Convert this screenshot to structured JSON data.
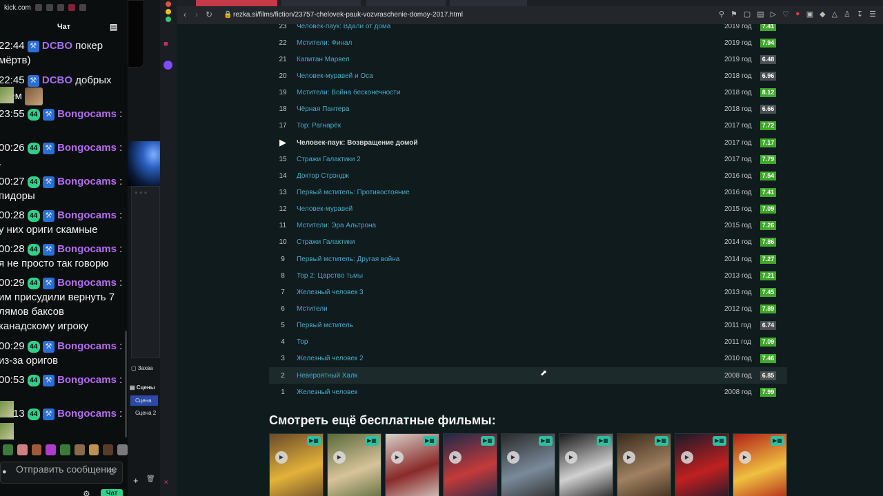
{
  "chat": {
    "site": "kick.com",
    "header": "Чат",
    "messages": [
      {
        "time": "22:44",
        "badges": [
          "hammer"
        ],
        "user": "DCBO",
        "text": "покер",
        "text2": "мёртв)"
      },
      {
        "time": "22:45",
        "badges": [
          "hammer"
        ],
        "user": "DCBO",
        "text": "добрых",
        "text2": "всем"
      },
      {
        "time": "23:55",
        "badges": [
          "44",
          "hammer"
        ],
        "user": "Bongocams",
        "text": ":",
        "text2": ""
      },
      {
        "time": "00:26",
        "badges": [
          "44",
          "hammer"
        ],
        "user": "Bongocams",
        "text": ":",
        "text2": "."
      },
      {
        "time": "00:27",
        "badges": [
          "44",
          "hammer"
        ],
        "user": "Bongocams",
        "text": ":",
        "text2": "пидоры"
      },
      {
        "time": "00:28",
        "badges": [
          "44",
          "hammer"
        ],
        "user": "Bongocams",
        "text": ":",
        "text2": "у них ориги скамные"
      },
      {
        "time": "00:28",
        "badges": [
          "44",
          "hammer"
        ],
        "user": "Bongocams",
        "text": ":",
        "text2": "я не просто так говорю"
      },
      {
        "time": "00:29",
        "badges": [
          "44",
          "hammer"
        ],
        "user": "Bongocams",
        "text": ":",
        "text2": "им присудили вернуть 7",
        "text3": "лямов баксов",
        "text4": "канадскому игроку"
      },
      {
        "time": "00:29",
        "badges": [
          "44",
          "hammer"
        ],
        "user": "Bongocams",
        "text": ":",
        "text2": "из-за оригов"
      },
      {
        "time": "00:53",
        "badges": [
          "44",
          "hammer"
        ],
        "user": "Bongocams",
        "text": ":",
        "text2": ""
      },
      {
        "time": "01:13",
        "badges": [
          "44",
          "hammer"
        ],
        "user": "Bongocams",
        "text": ":",
        "text2": ""
      }
    ],
    "input_placeholder": "Отправить сообщение",
    "send_label": "Чат"
  },
  "obs": {
    "capture_label": "Захва",
    "scenes_header": "Сцены",
    "scenes": [
      "Сцена",
      "Сцена 2"
    ]
  },
  "browser": {
    "url": "rezka.si/films/fiction/23757-chelovek-pauk-vozvraschenie-domoy-2017.html"
  },
  "list": [
    {
      "num": "23",
      "title": "Человек-паук: Вдали от дома",
      "year": "2019 год",
      "rating": "7.41",
      "color": "g"
    },
    {
      "num": "22",
      "title": "Мстители: Финал",
      "year": "2019 год",
      "rating": "7.94",
      "color": "g"
    },
    {
      "num": "21",
      "title": "Капитан Марвел",
      "year": "2019 год",
      "rating": "6.48",
      "color": "r"
    },
    {
      "num": "20",
      "title": "Человек-муравей и Оса",
      "year": "2018 год",
      "rating": "6.96",
      "color": "r"
    },
    {
      "num": "19",
      "title": "Мстители: Война бесконечности",
      "year": "2018 год",
      "rating": "8.12",
      "color": "g"
    },
    {
      "num": "18",
      "title": "Чёрная Пантера",
      "year": "2018 год",
      "rating": "6.66",
      "color": "r"
    },
    {
      "num": "17",
      "title": "Тор: Рагнарёк",
      "year": "2017 год",
      "rating": "7.72",
      "color": "g"
    },
    {
      "num": "",
      "title": "Человек-паук: Возвращение домой",
      "year": "2017 год",
      "rating": "7.17",
      "color": "g",
      "current": true
    },
    {
      "num": "15",
      "title": "Стражи Галактики 2",
      "year": "2017 год",
      "rating": "7.79",
      "color": "g"
    },
    {
      "num": "14",
      "title": "Доктор Стрэндж",
      "year": "2016 год",
      "rating": "7.54",
      "color": "g"
    },
    {
      "num": "13",
      "title": "Первый мститель: Противостояние",
      "year": "2016 год",
      "rating": "7.41",
      "color": "g"
    },
    {
      "num": "12",
      "title": "Человек-муравей",
      "year": "2015 год",
      "rating": "7.09",
      "color": "g"
    },
    {
      "num": "11",
      "title": "Мстители: Эра Альтрона",
      "year": "2015 год",
      "rating": "7.26",
      "color": "g"
    },
    {
      "num": "10",
      "title": "Стражи Галактики",
      "year": "2014 год",
      "rating": "7.86",
      "color": "g"
    },
    {
      "num": "9",
      "title": "Первый мститель: Другая война",
      "year": "2014 год",
      "rating": "7.27",
      "color": "g"
    },
    {
      "num": "8",
      "title": "Тор 2: Царство тьмы",
      "year": "2013 год",
      "rating": "7.21",
      "color": "g"
    },
    {
      "num": "7",
      "title": "Железный человек 3",
      "year": "2013 год",
      "rating": "7.45",
      "color": "g"
    },
    {
      "num": "6",
      "title": "Мстители",
      "year": "2012 год",
      "rating": "7.89",
      "color": "g"
    },
    {
      "num": "5",
      "title": "Первый мститель",
      "year": "2011 год",
      "rating": "6.74",
      "color": "r"
    },
    {
      "num": "4",
      "title": "Тор",
      "year": "2011 год",
      "rating": "7.09",
      "color": "g"
    },
    {
      "num": "3",
      "title": "Железный человек 2",
      "year": "2010 год",
      "rating": "7.46",
      "color": "g"
    },
    {
      "num": "2",
      "title": "Невероятный Халк",
      "year": "2008 год",
      "rating": "6.85",
      "color": "r",
      "hover": true
    },
    {
      "num": "1",
      "title": "Железный человек",
      "year": "2008 год",
      "rating": "7.99",
      "color": "g"
    }
  ],
  "more_title": "Смотреть ещё бесплатные фильмы:",
  "posters": [
    {
      "bg": "#6b4a2a",
      "accent": "#e2b23a"
    },
    {
      "bg": "#5a6a3a",
      "accent": "#d7c39a"
    },
    {
      "bg": "#d8d0c8",
      "accent": "#8a2a2a"
    },
    {
      "bg": "#1e2a4a",
      "accent": "#c43a3a"
    },
    {
      "bg": "#2a2a2a",
      "accent": "#7a8a9a"
    },
    {
      "bg": "#1a1a1a",
      "accent": "#d0d0d0"
    },
    {
      "bg": "#3a2a1a",
      "accent": "#a08060"
    },
    {
      "bg": "#1a1a2a",
      "accent": "#c02020"
    },
    {
      "bg": "#b0201a",
      "accent": "#f0c040"
    }
  ]
}
